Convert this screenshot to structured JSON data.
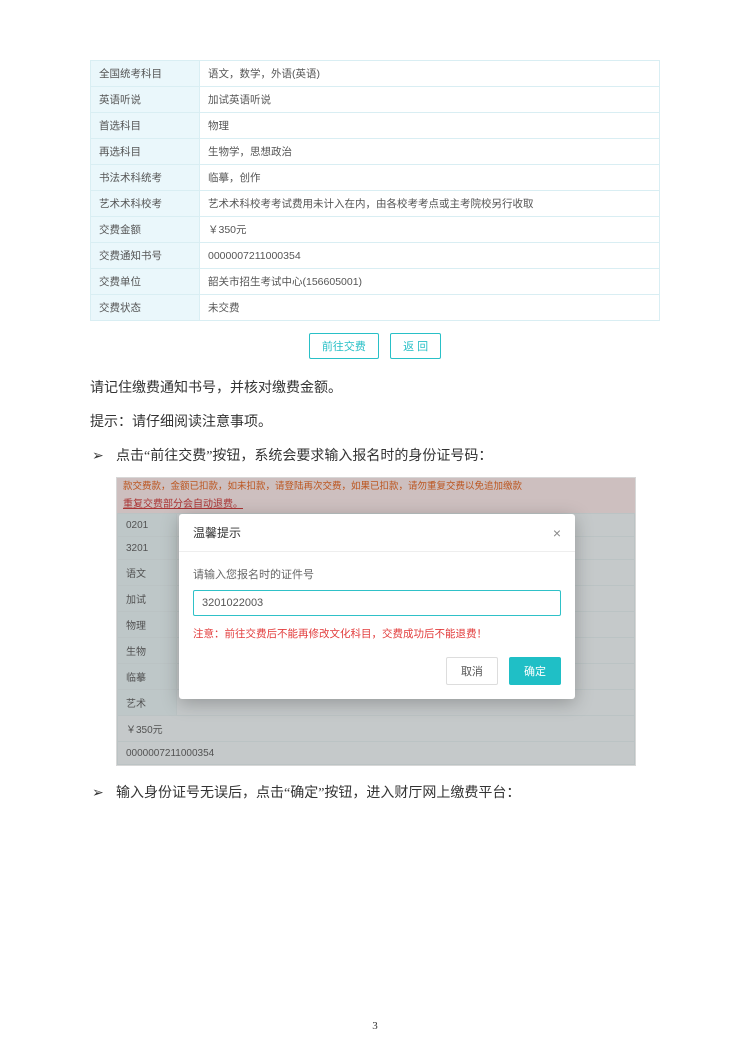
{
  "table": {
    "rows": [
      {
        "label": "全国统考科目",
        "value": "语文，数学，外语(英语)"
      },
      {
        "label": "英语听说",
        "value": "加试英语听说"
      },
      {
        "label": "首选科目",
        "value": "物理"
      },
      {
        "label": "再选科目",
        "value": "生物学，思想政治"
      },
      {
        "label": "书法术科统考",
        "value": "临摹，创作"
      },
      {
        "label": "艺术术科校考",
        "value": "艺术术科校考考试费用未计入在内，由各校考考点或主考院校另行收取"
      },
      {
        "label": "交费金额",
        "value": "￥350元"
      },
      {
        "label": "交费通知书号",
        "value": "0000007211000354"
      },
      {
        "label": "交费单位",
        "value": "韶关市招生考试中心(156605001)"
      },
      {
        "label": "交费状态",
        "value": "未交费"
      }
    ]
  },
  "buttons": {
    "pay": "前往交费",
    "back": "返 回"
  },
  "para1": "请记住缴费通知书号，并核对缴费金额。",
  "para2": "提示：请仔细阅读注意事项。",
  "bullet1": "点击“前往交费”按钮，系统会要求输入报名时的身份证号码：",
  "bullet2": "输入身份证号无误后，点击“确定”按钮，进入财厅网上缴费平台：",
  "shot1": {
    "topred1": "款交费款，金额已扣款，如未扣款，请登陆再次交费，如果已扣款，请勿重复交费以免追加缴款",
    "topred2": "重复交费部分会自动退费。",
    "bgRows": [
      {
        "lab": "0201"
      },
      {
        "lab": "3201"
      },
      {
        "lab": "语文"
      },
      {
        "lab": "加试"
      },
      {
        "lab": "物理"
      },
      {
        "lab": "生物"
      },
      {
        "lab": "临摹"
      },
      {
        "lab": "艺术"
      }
    ],
    "bgVal1": "￥350元",
    "bgVal2": "0000007211000354",
    "modal": {
      "title": "温馨提示",
      "label": "请输入您报名时的证件号",
      "inputValue": "3201022003",
      "warn": "注意：前往交费后不能再修改文化科目，交费成功后不能退费！",
      "cancel": "取消",
      "ok": "确定"
    }
  },
  "pageNum": "3"
}
